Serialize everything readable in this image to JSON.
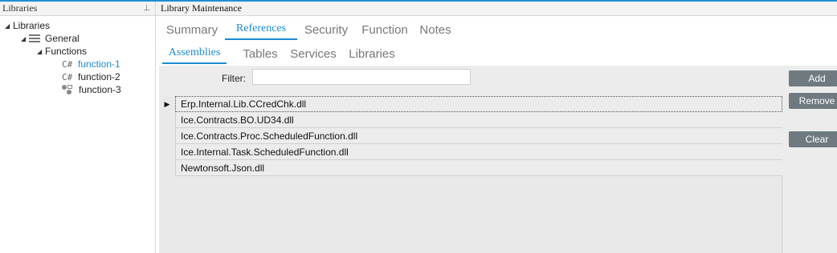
{
  "left_panel": {
    "title": "Libraries",
    "pin_icon": "pin-icon",
    "tree": {
      "root": "Libraries",
      "general": "General",
      "functions": "Functions",
      "items": [
        {
          "prefix": "C#",
          "label": "function-1",
          "selected": true
        },
        {
          "prefix": "C#",
          "label": "function-2",
          "selected": false
        },
        {
          "prefix": "",
          "label": "function-3",
          "selected": false
        }
      ]
    }
  },
  "main": {
    "title": "Library Maintenance",
    "tabs": [
      "Summary",
      "References",
      "Security",
      "Function",
      "Notes"
    ],
    "active_tab": "References",
    "subtabs": [
      "Assemblies",
      "Tables",
      "Services",
      "Libraries"
    ],
    "active_subtab": "Assemblies",
    "filter": {
      "label": "Filter:",
      "value": "",
      "placeholder": ""
    },
    "assemblies": [
      "Erp.Internal.Lib.CCredChk.dll",
      "Ice.Contracts.BO.UD34.dll",
      "Ice.Contracts.Proc.ScheduledFunction.dll",
      "Ice.Internal.Task.ScheduledFunction.dll",
      "Newtonsoft.Json.dll"
    ],
    "buttons": {
      "add": "Add",
      "remove": "Remove",
      "clear": "Clear"
    }
  },
  "colors": {
    "accent": "#1b8ad6",
    "button": "#6e7a80",
    "panel": "#ececec"
  }
}
